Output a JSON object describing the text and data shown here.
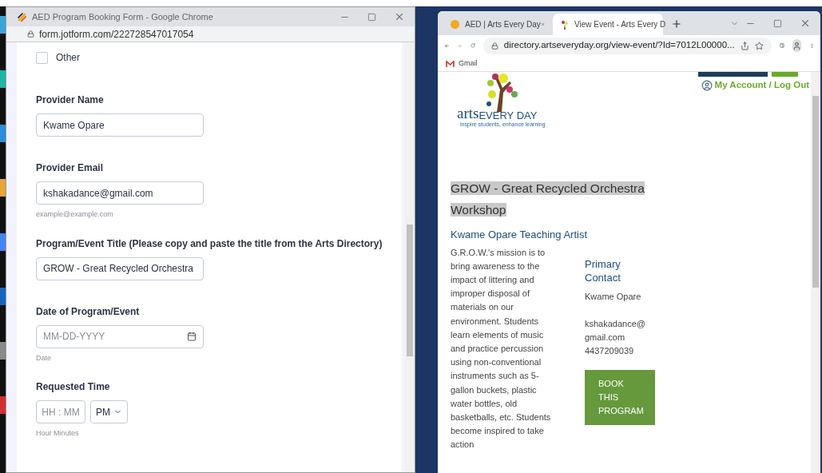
{
  "form_window": {
    "title": "AED Program Booking Form - Google Chrome",
    "url": "form.jotform.com/222728547017054",
    "options": [
      {
        "label": "Other",
        "checked": false
      }
    ],
    "fields": [
      {
        "kind": "text",
        "label": "Provider Name",
        "value": "Kwame Opare"
      },
      {
        "kind": "text",
        "label": "Provider Email",
        "value": "kshakadance@gmail.com",
        "hint": "example@example.com"
      },
      {
        "kind": "text",
        "label": "Program/Event Title (Please copy and paste the title from the Arts Directory)",
        "value": "GROW - Great Recycled Orchestra"
      },
      {
        "kind": "date",
        "label": "Date of Program/Event",
        "placeholder": "MM-DD-YYYY",
        "hint": "Date"
      }
    ],
    "time": {
      "label": "Requested Time",
      "placeholder": "HH : MM",
      "period": "PM",
      "hint": "Hour Minutes"
    }
  },
  "browser_window": {
    "tabs": [
      {
        "title": "AED | Arts Every Day",
        "selected": false
      },
      {
        "title": "View Event - Arts Every D",
        "selected": true
      }
    ],
    "url": "directory.artseveryday.org/view-event/?Id=7012L00000...",
    "bookmarks": [
      "Gmail"
    ],
    "page": {
      "account_link": "My Account / Log Out",
      "logo": {
        "word": "arts",
        "words": "EVERY DAY",
        "tagline": "inspire students, enhance learning"
      },
      "title": "GROW - Great Recycled Orchestra Workshop",
      "title_highlighted": true,
      "subtitle": "Kwame Opare Teaching Artist",
      "description": "G.R.O.W.'s mission is to bring awareness to the impact of littering and improper disposal of materials on our environment. Students learn elements of music and practice percussion using non-conventional instruments such as 5-gallon buckets, plastic water bottles, old basketballs, etc. Students become inspired to take action",
      "contact": {
        "heading": "Primary Contact",
        "name": "Kwame Opare",
        "email": "kshakadance@gmail.com",
        "phone": "4437209039"
      },
      "book_button": "BOOK THIS PROGRAM"
    }
  }
}
